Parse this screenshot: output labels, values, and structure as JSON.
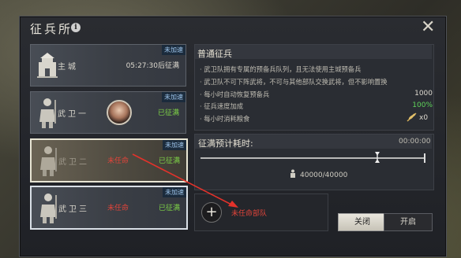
{
  "window": {
    "title": "征兵所",
    "info_icon": "info-icon",
    "close_icon": "close-icon"
  },
  "slots": [
    {
      "name": "主城",
      "tag": "未加速",
      "status": "05:27:30后征满",
      "icon": "fortress-icon"
    },
    {
      "name": "武卫一",
      "tag": "未加速",
      "status": "已征满",
      "icon": "soldier-icon",
      "general": "general-portrait"
    },
    {
      "name": "武卫二",
      "tag": "未加速",
      "status": "已征满",
      "appoint": "未任命",
      "icon": "soldier-icon"
    },
    {
      "name": "武卫三",
      "tag": "未加速",
      "status": "已征满",
      "appoint": "未任命",
      "icon": "soldier-icon"
    }
  ],
  "info": {
    "heading": "普通征兵",
    "lines": [
      "· 武卫队拥有专属的预备兵队列，且无法使用主城预备兵",
      "· 武卫队不可下阵武将，不可与其他部队交换武将，但不影响置换"
    ],
    "stats": [
      {
        "label": "· 每小时自动恢复预备兵",
        "value": "1000"
      },
      {
        "label": "· 征兵速度加成",
        "value": "100%"
      },
      {
        "label": "· 每小时消耗粮食",
        "value": "x0",
        "icon": "grain-icon"
      }
    ]
  },
  "recruit": {
    "label": "征满预计耗时:",
    "time": "00:00:00",
    "slider_level": 0.79,
    "count": "40000/40000"
  },
  "troop": {
    "label": "未任命部队"
  },
  "buttons": {
    "close": "关闭",
    "open": "开启"
  }
}
